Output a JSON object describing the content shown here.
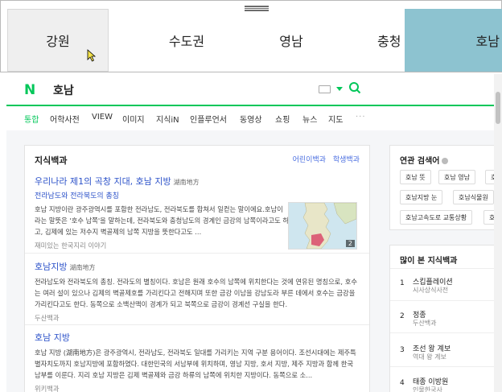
{
  "regions": [
    "강원",
    "수도권",
    "영남",
    "충청",
    "호남"
  ],
  "search": {
    "logo": "N",
    "query": "호남"
  },
  "tabs": [
    "통합",
    "어학사전",
    "VIEW",
    "이미지",
    "지식iN",
    "인플루언서",
    "동영상",
    "쇼핑",
    "뉴스",
    "지도",
    "···"
  ],
  "knowledge": {
    "title": "지식백과",
    "links": [
      "어린이백과",
      "학생백과"
    ],
    "entries": [
      {
        "title": "우리나라 제1의 곡창 지대, 호남 지방",
        "hanja": "湖南地方",
        "subtitle": "전라남도와 전라북도의 총칭",
        "desc": "호남 지방이란 광주광역시를 포함한 전라남도, 전라북도를 합쳐서 일컫는 말이에요.호남이라는 말뜻은 '호수 남쪽'을 말하는데, 전라북도와 충청남도의 경계인 금강의 남쪽이라고도 하고, 김제에 있는 저수지 벽골제의 남쪽 지방을 뜻한다고도 ...",
        "source": "재미있는 한국지리 이야기",
        "image_count": "2"
      },
      {
        "title": "호남지방",
        "hanja": "湖南地方",
        "desc": "전라남도와 전라북도의 총칭. 전라도의 별칭이다. 호남은 원래 호수의 남쪽에 위치한다는 것에 연유된 명칭으로, 호수는 여러 설이 있으나 김제의 벽골제호를 가리킨다고 전해지며 또한 금강 이남을 강남도라 부른 데에서 호수는 금강을 가리킨다고도 한다. 동쪽으로 소백산맥이 경계가 되고 북쪽으로 금강이 경계선 구실을 한다.",
        "source": "두산백과"
      },
      {
        "title": "호남 지방",
        "hanja": "",
        "desc": "호남 지방 (湖南地方)은 광주광역시, 전라남도, 전라북도 일대를 가리키는 지역 구분 용어이다. 조선시대에는 제주특별자치도까지 호남지방에 포함하였다. 대한민국의 서남부에 위치하며, 영남 지방, 호서 지방, 제주 지방과 함께 한국 남부를 이룬다. 지리 호남 지방은 김제 벽골제와 금강 하류의 남쪽에 위치한 지방이다. 동쪽으로 소...",
        "source": "위키백과"
      }
    ]
  },
  "related": {
    "title": "연관 검색어",
    "chips": [
      "호남 뜻",
      "호남 영남",
      "호",
      "호남지방 눈",
      "호남식물원",
      "호남고속도로 교통상황",
      "호"
    ]
  },
  "popular": {
    "title": "많이 본 지식백과",
    "items": [
      {
        "num": "1",
        "name": "스킵플레이션",
        "sub": "시사상식사전"
      },
      {
        "num": "2",
        "name": "정종",
        "sub": "두산백과"
      },
      {
        "num": "3",
        "name": "조선 왕 계보",
        "sub": "역대 왕 계보"
      },
      {
        "num": "4",
        "name": "태종 이방원",
        "sub": "인물한국사"
      }
    ]
  },
  "colors": {
    "accent": "#03c75a",
    "selected_region": "#8dc3d0",
    "link": "#2c52c9"
  }
}
